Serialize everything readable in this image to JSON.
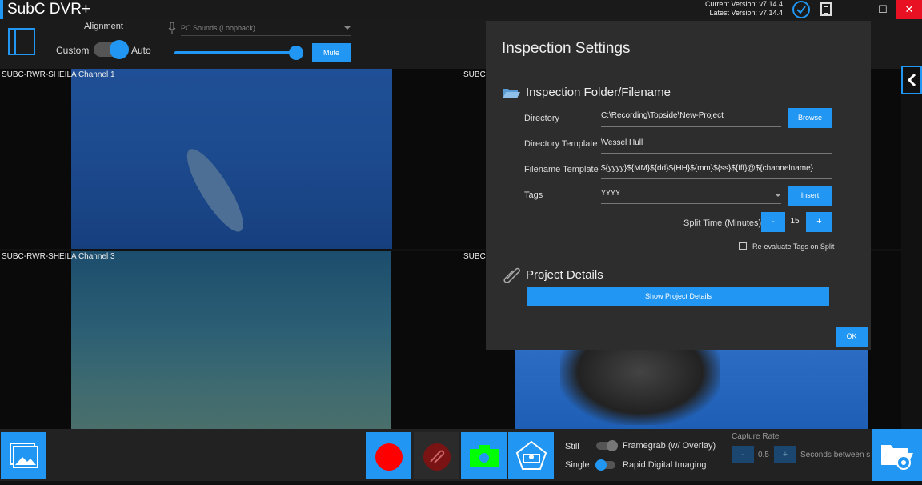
{
  "titlebar": {
    "app_title": "SubC DVR+",
    "current_version": "Current Version: v7.14.4",
    "latest_version": "Latest Version: v7.14.4",
    "min": "—",
    "max": "☐",
    "close": "✕"
  },
  "topbar": {
    "alignment_label": "Alignment",
    "custom_label": "Custom",
    "auto_label": "Auto",
    "audio_source": "PC Sounds (Loopback)",
    "mute_label": "Mute",
    "volume_level": 0.95
  },
  "channels": [
    "SUBC-RWR-SHEILA Channel 1",
    "SUBC-",
    "SUBC-RWR-SHEILA Channel 3",
    "SUBC-"
  ],
  "dialog": {
    "title": "Inspection Settings",
    "folder_section": "Inspection Folder/Filename",
    "directory_label": "Directory",
    "directory_value": "C:\\Recording\\Topside\\New-Project",
    "browse_label": "Browse",
    "dir_template_label": "Directory Template",
    "dir_template_value": "\\Vessel Hull",
    "file_template_label": "Filename Template",
    "file_template_value": "${yyyy}${MM}${dd}${HH}${mm}${ss}${fff}@${channelname}",
    "tags_label": "Tags",
    "tags_value": "YYYY",
    "insert_label": "Insert",
    "split_label": "Split Time (Minutes)",
    "split_minus": "-",
    "split_value": "15",
    "split_plus": "+",
    "reeval_label": "Re-evaluate Tags on Split",
    "reeval_checked": false,
    "project_section": "Project Details",
    "show_project_label": "Show Project Details",
    "ok_label": "OK"
  },
  "bottom": {
    "still_label": "Still",
    "single_label": "Single",
    "framegrab_label": "Framegrab (w/ Overlay)",
    "rapid_label": "Rapid Digital Imaging",
    "capture_rate_label": "Capture Rate",
    "capture_minus": "-",
    "capture_value": "0.5",
    "capture_plus": "+",
    "seconds_label": "Seconds between s"
  },
  "colors": {
    "accent": "#2196f3",
    "record": "#ff0000",
    "snapshot": "#00ff00",
    "close": "#e81123"
  }
}
